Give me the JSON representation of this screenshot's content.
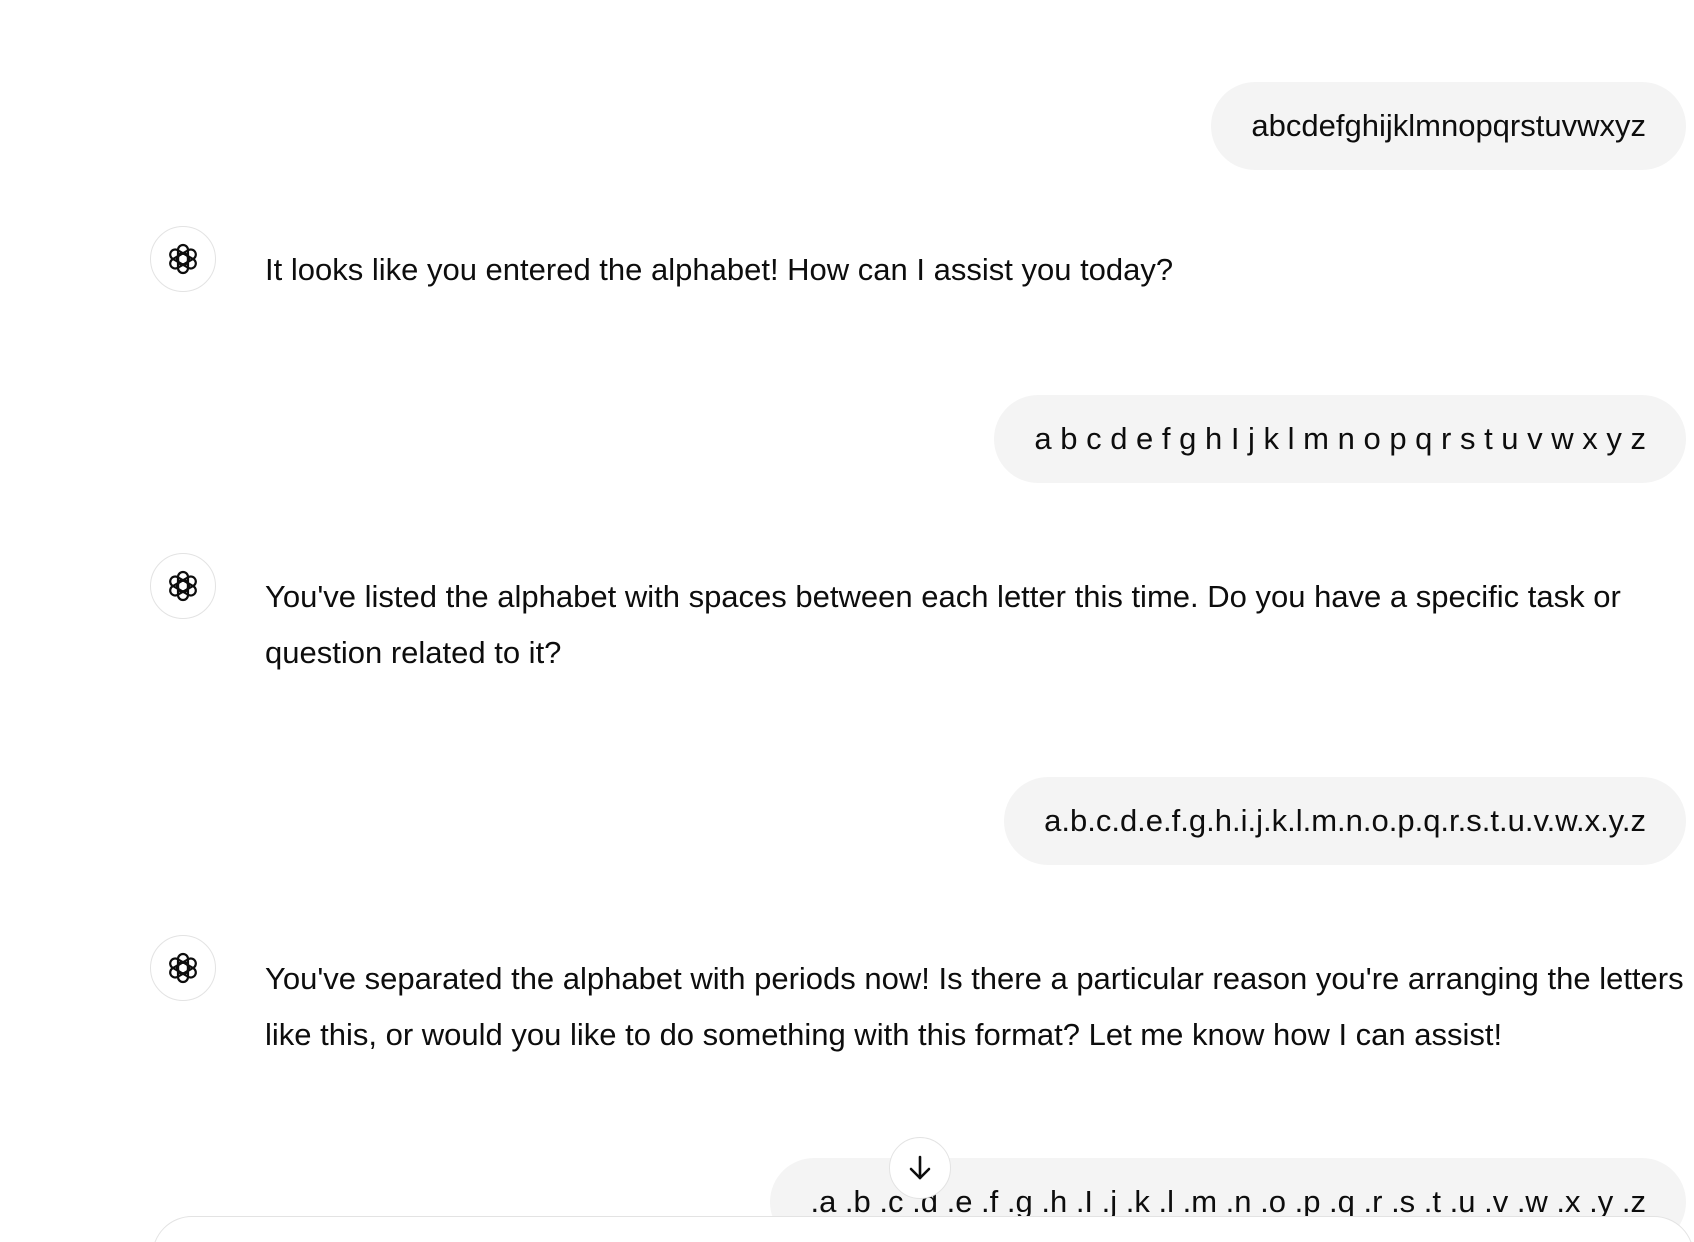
{
  "conversation": {
    "messages": [
      {
        "role": "user",
        "text": "abcdefghijklmnopqrstuvwxyz"
      },
      {
        "role": "assistant",
        "text": "It looks like you entered the alphabet! How can I assist you today?"
      },
      {
        "role": "user",
        "text": "a b c d e f g h I j k l m n o p q r s t u v w x y z"
      },
      {
        "role": "assistant",
        "text": "You've listed the alphabet with spaces between each letter this time. Do you have a specific task or question related to it?"
      },
      {
        "role": "user",
        "text": "a.b.c.d.e.f.g.h.i.j.k.l.m.n.o.p.q.r.s.t.u.v.w.x.y.z"
      },
      {
        "role": "assistant",
        "text": "You've separated the alphabet with periods now! Is there a particular reason you're arranging the letters like this, or would you like to do something with this format? Let me know how I can assist!"
      },
      {
        "role": "user",
        "text": ".a .b .c .d .e .f .g .h .I .j .k .l .m .n .o .p .q .r .s .t .u .v .w .x .y .z"
      }
    ]
  },
  "icons": {
    "assistant_avatar": "openai-logo-icon",
    "scroll_button": "arrow-down-icon"
  },
  "colors": {
    "user_bubble": "#f4f4f4",
    "text": "#0d0d0d",
    "border": "#e3e3e3"
  }
}
